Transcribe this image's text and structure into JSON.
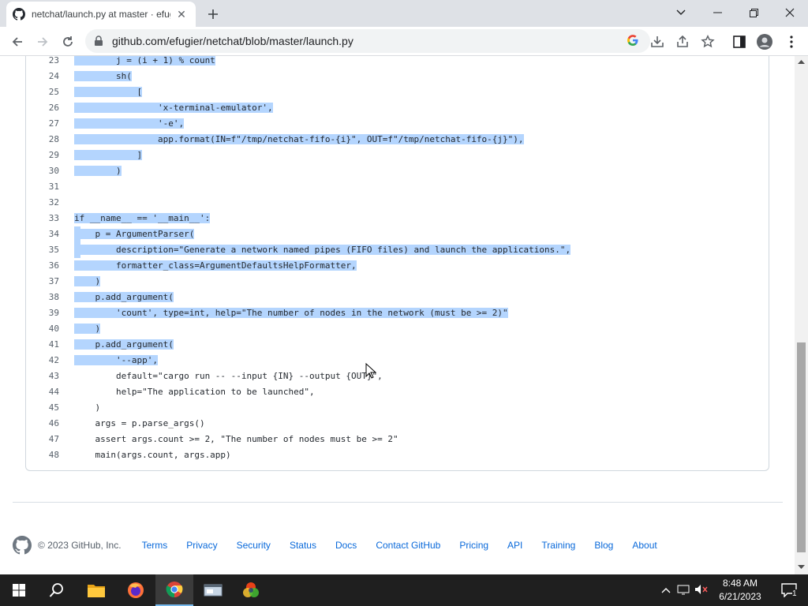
{
  "browser": {
    "tab_title": "netchat/launch.py at master · efugier/netchat",
    "url": "github.com/efugier/netchat/blob/master/launch.py"
  },
  "code_lines": [
    {
      "n": "23",
      "text": "        j = (i + 1) % count"
    },
    {
      "n": "24",
      "text": "        sh("
    },
    {
      "n": "25",
      "text": "            ["
    },
    {
      "n": "26",
      "text": "                'x-terminal-emulator',"
    },
    {
      "n": "27",
      "text": "                '-e',"
    },
    {
      "n": "28",
      "text": "                app.format(IN=f\"/tmp/netchat-fifo-{i}\", OUT=f\"/tmp/netchat-fifo-{j}\"),"
    },
    {
      "n": "29",
      "text": "            ]"
    },
    {
      "n": "30",
      "text": "        )"
    },
    {
      "n": "31",
      "text": ""
    },
    {
      "n": "32",
      "text": ""
    },
    {
      "n": "33",
      "text": "if __name__ == '__main__':"
    },
    {
      "n": "34",
      "text": "    p = ArgumentParser("
    },
    {
      "n": "35",
      "text": "        description=\"Generate a network named pipes (FIFO files) and launch the applications.\","
    },
    {
      "n": "36",
      "text": "        formatter_class=ArgumentDefaultsHelpFormatter,"
    },
    {
      "n": "37",
      "text": "    )"
    },
    {
      "n": "38",
      "text": "    p.add_argument("
    },
    {
      "n": "39",
      "text": "        'count', type=int, help=\"The number of nodes in the network (must be >= 2)\""
    },
    {
      "n": "40",
      "text": "    )"
    },
    {
      "n": "41",
      "text": "    p.add_argument("
    },
    {
      "n": "42",
      "text": "        '--app',"
    },
    {
      "n": "43",
      "text": "        default=\"cargo run -- --input {IN} --output {OUT}\","
    },
    {
      "n": "44",
      "text": "        help=\"The application to be launched\","
    },
    {
      "n": "45",
      "text": "    )"
    },
    {
      "n": "46",
      "text": "    args = p.parse_args()"
    },
    {
      "n": "47",
      "text": "    assert args.count >= 2, \"The number of nodes must be >= 2\""
    },
    {
      "n": "48",
      "text": "    main(args.count, args.app)"
    }
  ],
  "footer": {
    "copyright": "© 2023 GitHub, Inc.",
    "links": [
      "Terms",
      "Privacy",
      "Security",
      "Status",
      "Docs",
      "Contact GitHub",
      "Pricing",
      "API",
      "Training",
      "Blog",
      "About"
    ]
  },
  "taskbar": {
    "time": "8:48 AM",
    "date": "6/21/2023",
    "notification_count": "1"
  },
  "colors": {
    "selection": "#b4d5fe",
    "link": "#0969da",
    "keyword": "#cf222e",
    "function": "#8250df"
  }
}
